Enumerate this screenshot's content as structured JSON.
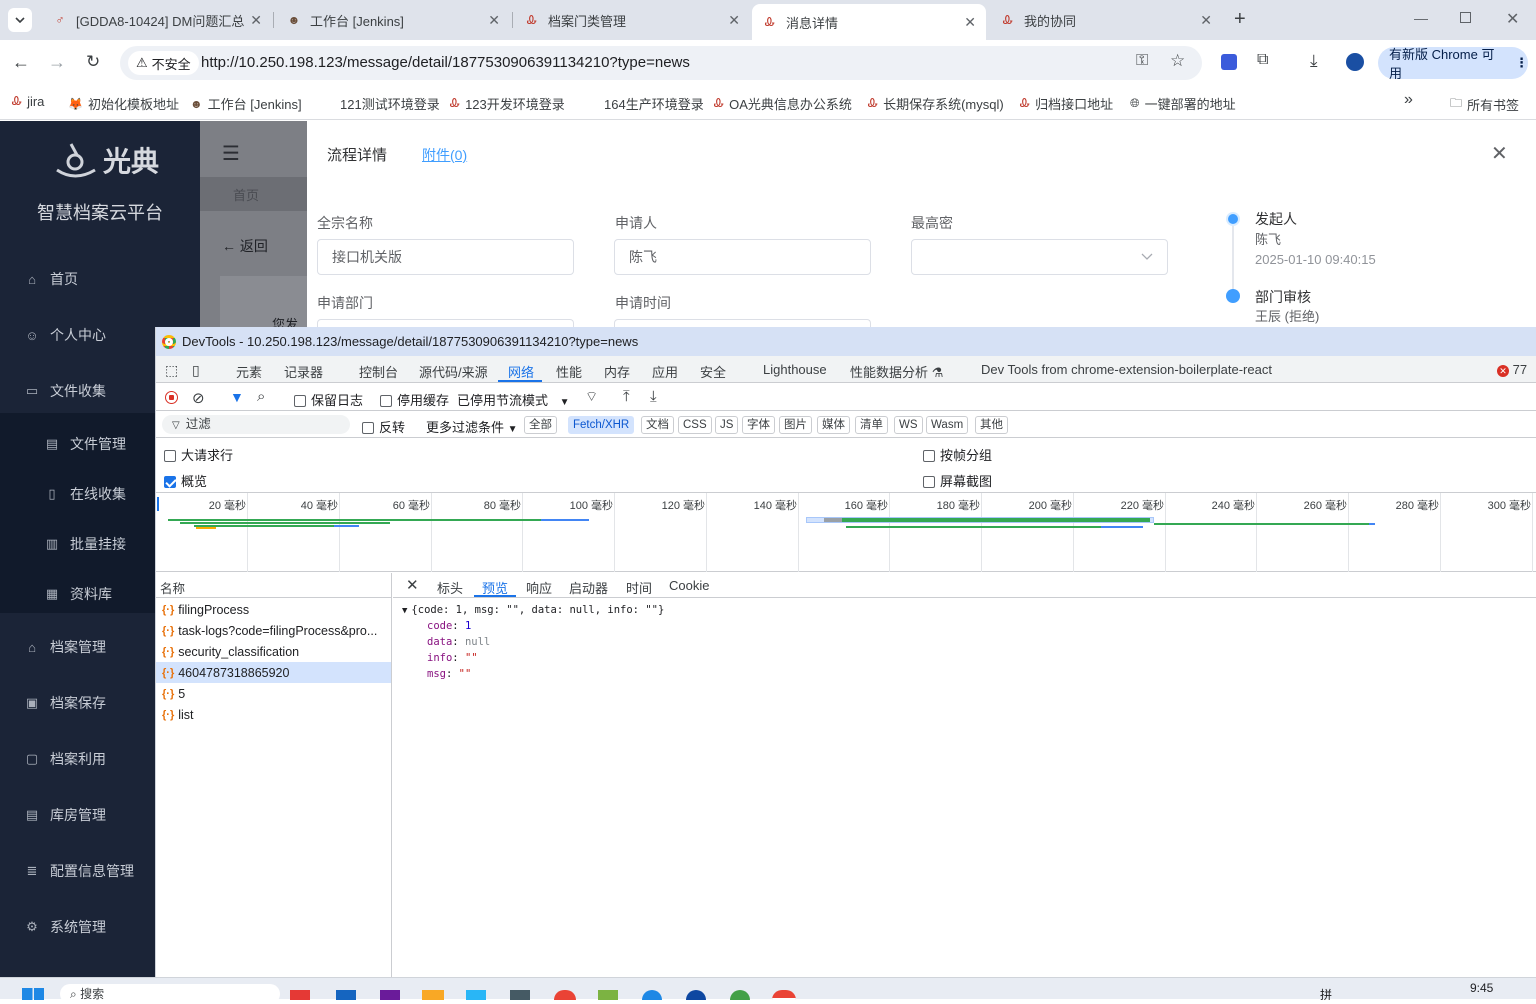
{
  "browser": {
    "tabs": [
      {
        "label": "[GDDA8-10424] DM问题汇总",
        "icon": "jira-icon"
      },
      {
        "label": "工作台 [Jenkins]",
        "icon": "jenkins-icon"
      },
      {
        "label": "档案门类管理",
        "icon": "app-icon"
      },
      {
        "label": "消息详情",
        "icon": "app-icon",
        "active": true
      },
      {
        "label": "我的协同",
        "icon": "app-icon"
      }
    ],
    "security_label": "不安全",
    "url": "http://10.250.198.123/message/detail/1877530906391134210?type=news",
    "update_label": "有新版 Chrome 可用",
    "bookmarks": [
      "jira",
      "初始化模板地址",
      "工作台 [Jenkins]",
      "121测试环境登录",
      "123开发环境登录",
      "164生产环境登录",
      "OA光典信息办公系统",
      "长期保存系统(mysql)",
      "归档接口地址",
      "一键部署的地址"
    ],
    "all_bookmarks": "所有书签",
    "more": "»"
  },
  "sidebar": {
    "brand": "光典",
    "platform": "智慧档案云平台",
    "items": [
      {
        "label": "首页",
        "icon": "home-icon"
      },
      {
        "label": "个人中心",
        "icon": "user-icon"
      },
      {
        "label": "文件收集",
        "icon": "folder-icon"
      },
      {
        "label": "文件管理",
        "icon": "file-icon",
        "sub": true
      },
      {
        "label": "在线收集",
        "icon": "doc-icon",
        "sub": true
      },
      {
        "label": "批量挂接",
        "icon": "bar-chart-icon",
        "sub": true
      },
      {
        "label": "资料库",
        "icon": "calendar-icon",
        "sub": true
      },
      {
        "label": "档案管理",
        "icon": "bank-icon"
      },
      {
        "label": "档案保存",
        "icon": "archive-icon"
      },
      {
        "label": "档案利用",
        "icon": "clipboard-icon"
      },
      {
        "label": "库房管理",
        "icon": "building-icon"
      },
      {
        "label": "配置信息管理",
        "icon": "list-icon"
      },
      {
        "label": "系统管理",
        "icon": "gear-icon"
      }
    ]
  },
  "page": {
    "breadcrumb_home": "首页",
    "back": "返回",
    "partial_text": "您发起"
  },
  "dialog": {
    "tab_process": "流程详情",
    "tab_attachment": "附件(0)",
    "fields": {
      "quanzong_label": "全宗名称",
      "quanzong_value": "接口机关版",
      "applicant_label": "申请人",
      "applicant_value": "陈飞",
      "secret_label": "最高密",
      "dept_label": "申请部门",
      "time_label": "申请时间"
    },
    "timeline": [
      {
        "title": "发起人",
        "person": "陈飞",
        "time": "2025-01-10 09:40:15"
      },
      {
        "title": "部门审核",
        "person": "王辰 (拒绝)"
      }
    ]
  },
  "devtools": {
    "title": "DevTools - 10.250.198.123/message/detail/1877530906391134210?type=news",
    "tabs": [
      "元素",
      "记录器",
      "控制台",
      "源代码/来源",
      "网络",
      "性能",
      "内存",
      "应用",
      "安全",
      "Lighthouse",
      "性能数据分析",
      "Dev Tools from chrome-extension-boilerplate-react"
    ],
    "active_tab": "网络",
    "error_count": "77",
    "toolbar": {
      "preserve_log": "保留日志",
      "disable_cache": "停用缓存",
      "throttle": "已停用节流模式"
    },
    "filter": {
      "placeholder": "过滤",
      "invert": "反转",
      "more_filters": "更多过滤条件",
      "chips": [
        "全部",
        "Fetch/XHR",
        "文档",
        "CSS",
        "JS",
        "字体",
        "图片",
        "媒体",
        "清单",
        "WS",
        "Wasm",
        "其他"
      ],
      "active_chip": "Fetch/XHR"
    },
    "options": {
      "big_rows": "大请求行",
      "overview": "概览",
      "group_by_frame": "按帧分组",
      "screenshots": "屏幕截图"
    },
    "timeline_ticks": [
      "20 毫秒",
      "40 毫秒",
      "60 毫秒",
      "80 毫秒",
      "100 毫秒",
      "120 毫秒",
      "140 毫秒",
      "160 毫秒",
      "180 毫秒",
      "200 毫秒",
      "220 毫秒",
      "240 毫秒",
      "260 毫秒",
      "280 毫秒",
      "300 毫秒"
    ],
    "name_header": "名称",
    "requests": [
      "filingProcess",
      "task-logs?code=filingProcess&pro...",
      "security_classification",
      "4604787318865920",
      "5",
      "list"
    ],
    "selected_request": "4604787318865920",
    "detail_tabs": [
      "标头",
      "预览",
      "响应",
      "启动器",
      "时间",
      "Cookie"
    ],
    "active_detail_tab": "预览",
    "preview": {
      "summary": "{code: 1, msg: \"\", data: null, info: \"\"}",
      "lines": [
        {
          "key": "code",
          "value": "1"
        },
        {
          "key": "data",
          "value": "null"
        },
        {
          "key": "info",
          "value": "\"\""
        },
        {
          "key": "msg",
          "value": "\"\""
        }
      ]
    }
  },
  "taskbar": {
    "search": "搜索",
    "time": "9:45",
    "ime": "拼"
  },
  "colors": {
    "sidebar_bg": "#1b2437",
    "accent_blue": "#1a73e8",
    "link_blue": "#409eff",
    "devtools_title": "#d6e1f5"
  }
}
